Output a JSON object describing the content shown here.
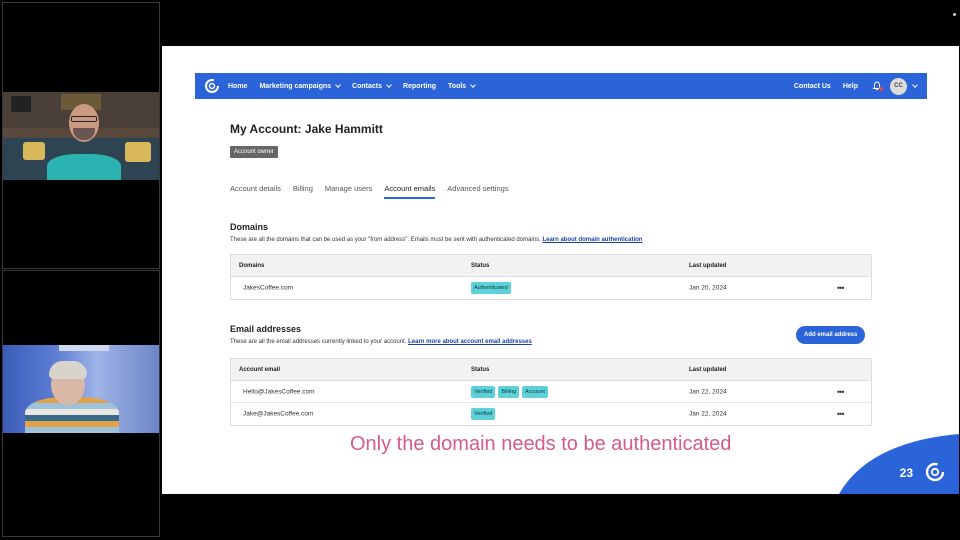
{
  "nav": {
    "items": [
      {
        "label": "Home",
        "dropdown": false
      },
      {
        "label": "Marketing campaigns",
        "dropdown": true
      },
      {
        "label": "Contacts",
        "dropdown": true
      },
      {
        "label": "Reporting",
        "dropdown": false
      },
      {
        "label": "Tools",
        "dropdown": true
      }
    ],
    "contact_us": "Contact Us",
    "help": "Help",
    "avatar_initials": "CC"
  },
  "account": {
    "title": "My Account: Jake Hammitt",
    "badge": "Account owner"
  },
  "tabs": [
    {
      "label": "Account details",
      "active": false
    },
    {
      "label": "Billing",
      "active": false
    },
    {
      "label": "Manage users",
      "active": false
    },
    {
      "label": "Account emails",
      "active": true
    },
    {
      "label": "Advanced settings",
      "active": false
    }
  ],
  "domains": {
    "title": "Domains",
    "description": "These are all the domains that can be used as your \"from address\". Emails must be sent with authenticated domains.",
    "link": "Learn about domain authentication",
    "columns": [
      "Domains",
      "Status",
      "Last updated"
    ],
    "rows": [
      {
        "name": "JakesCoffee.com",
        "statuses": [
          "Authenticated"
        ],
        "updated": "Jan 20, 2024",
        "menu": "•••"
      }
    ]
  },
  "emails": {
    "title": "Email addresses",
    "description": "These are all the email addresses currently linked to your account.",
    "link": "Learn more about account email addresses",
    "add_button": "Add email address",
    "columns": [
      "Account email",
      "Status",
      "Last updated"
    ],
    "rows": [
      {
        "name": "Hello@JakesCoffee.com",
        "statuses": [
          "Verified",
          "Billing",
          "Account"
        ],
        "updated": "Jan 22, 2024",
        "menu": "•••"
      },
      {
        "name": "Jake@JakesCoffee.com",
        "statuses": [
          "Verified"
        ],
        "updated": "Jan 22, 2024",
        "menu": "•••"
      }
    ]
  },
  "slide": {
    "caption": "Only the domain needs to be authenticated",
    "page_number": "23"
  },
  "colors": {
    "nav_blue": "#2b63d9",
    "pill_teal": "#5ed0d8",
    "caption_pink": "#d65a8a"
  }
}
